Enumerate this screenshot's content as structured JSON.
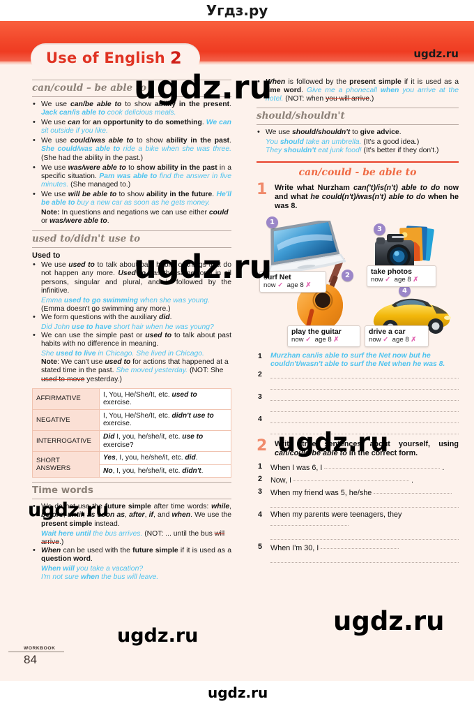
{
  "site": {
    "brand_top": "Угдз.ру",
    "brand_bottom": "ugdz.ru",
    "watermarks": [
      "ugdz.ru",
      "ugdz.ru",
      "ugdz.ru",
      "ugdz.ru",
      "ugdz.ru",
      "ugdz.ru",
      "ugdz.ru"
    ]
  },
  "header": {
    "title": "Use of English",
    "number": "2",
    "corner_brand": "ugdz.ru"
  },
  "footer": {
    "label": "WORKBOOK",
    "page": "84"
  },
  "left": {
    "s1": {
      "heading": "can/could – be able to",
      "bullets": [
        {
          "parts": [
            {
              "t": "We use ",
              "s": "n"
            },
            {
              "t": "can/be able to",
              "s": "bi"
            },
            {
              "t": " to show ",
              "s": "n"
            },
            {
              "t": "ability in the present",
              "s": "b"
            },
            {
              "t": ". ",
              "s": "n"
            },
            {
              "t": "Jack can/is able to",
              "s": "exb"
            },
            {
              "t": " cook delicious meals.",
              "s": "ex"
            }
          ]
        },
        {
          "parts": [
            {
              "t": "We use ",
              "s": "n"
            },
            {
              "t": "can",
              "s": "bi"
            },
            {
              "t": " for ",
              "s": "n"
            },
            {
              "t": "an opportunity to do something",
              "s": "b"
            },
            {
              "t": ". ",
              "s": "n"
            },
            {
              "t": "We can",
              "s": "exb"
            },
            {
              "t": " sit outside if you like.",
              "s": "ex"
            }
          ]
        },
        {
          "parts": [
            {
              "t": "We use ",
              "s": "n"
            },
            {
              "t": "could/was able to",
              "s": "bi"
            },
            {
              "t": " to show ",
              "s": "n"
            },
            {
              "t": "ability in the past",
              "s": "b"
            },
            {
              "t": ". ",
              "s": "n"
            },
            {
              "t": "She could/was able to",
              "s": "exb"
            },
            {
              "t": " ride a bike when she was three.",
              "s": "ex"
            },
            {
              "t": " (She had the ability in the past.)",
              "s": "n"
            }
          ]
        },
        {
          "parts": [
            {
              "t": "We use ",
              "s": "n"
            },
            {
              "t": "was/were able to",
              "s": "bi"
            },
            {
              "t": " to ",
              "s": "n"
            },
            {
              "t": "show ability in the past",
              "s": "b"
            },
            {
              "t": " in a specific situation. ",
              "s": "n"
            },
            {
              "t": "Pam was able to",
              "s": "exb"
            },
            {
              "t": " find the answer in five minutes.",
              "s": "ex"
            },
            {
              "t": " (She managed to.)",
              "s": "n"
            }
          ]
        },
        {
          "parts": [
            {
              "t": "We use ",
              "s": "n"
            },
            {
              "t": "will be able to",
              "s": "bi"
            },
            {
              "t": " to show ",
              "s": "n"
            },
            {
              "t": "ability in the future",
              "s": "b"
            },
            {
              "t": ". ",
              "s": "n"
            },
            {
              "t": "He'll be able to",
              "s": "exb"
            },
            {
              "t": " buy a new car as soon as he gets money.",
              "s": "ex"
            }
          ]
        }
      ],
      "note": {
        "parts": [
          {
            "t": "Note:",
            "s": "b"
          },
          {
            "t": " In questions and negations we can use either ",
            "s": "n"
          },
          {
            "t": "could",
            "s": "bi"
          },
          {
            "t": " or ",
            "s": "n"
          },
          {
            "t": "was/were able to",
            "s": "bi"
          },
          {
            "t": ".",
            "s": "n"
          }
        ]
      }
    },
    "s2": {
      "heading": "used to/didn't use to",
      "subhead": "Used to",
      "bullets": [
        {
          "parts": [
            {
              "t": "We use ",
              "s": "n"
            },
            {
              "t": "used to",
              "s": "bi"
            },
            {
              "t": " to talk about past habits or things that do not happen any more. ",
              "s": "n"
            },
            {
              "t": "Used to",
              "s": "bi"
            },
            {
              "t": " has the same form in all persons, singular and plural, and is followed by the infinitive.",
              "s": "n"
            }
          ]
        },
        {
          "parts": [
            {
              "t": "We form questions with the auxiliary ",
              "s": "n"
            },
            {
              "t": "did",
              "s": "bi"
            },
            {
              "t": ".",
              "s": "n"
            }
          ]
        },
        {
          "parts": [
            {
              "t": "We can use the simple past or ",
              "s": "n"
            },
            {
              "t": "used to",
              "s": "bi"
            },
            {
              "t": " to talk about past habits with no difference in meaning.",
              "s": "n"
            }
          ]
        }
      ],
      "ex1a": "Emma used to go swimming when she was young.",
      "ex1a_bold": "used to go swimming",
      "ex1b": "(Emma doesn't go swimming any more.)",
      "ex2a": "Did John use to have short hair when he was young?",
      "ex3a": "She used to live in Chicago. She lived in Chicago.",
      "note": {
        "parts": [
          {
            "t": "Note",
            "s": "b"
          },
          {
            "t": ": We can't use ",
            "s": "n"
          },
          {
            "t": "used to",
            "s": "bi"
          },
          {
            "t": " for actions that happened at a stated time in the past. ",
            "s": "n"
          },
          {
            "t": "She moved yesterday.",
            "s": "ex"
          },
          {
            "t": " (NOT: She ",
            "s": "n"
          },
          {
            "t": "used to move",
            "s": "strike"
          },
          {
            "t": " yesterday.)",
            "s": "n"
          }
        ]
      },
      "table": {
        "rows": [
          {
            "label": "AFFIRMATIVE",
            "cells": [
              [
                {
                  "t": "I, You, He/She/It, etc. ",
                  "s": "n"
                },
                {
                  "t": "used to",
                  "s": "bi"
                },
                {
                  "t": " exercise.",
                  "s": "n"
                }
              ]
            ]
          },
          {
            "label": "NEGATIVE",
            "cells": [
              [
                {
                  "t": "I, You, He/She/It, etc. ",
                  "s": "n"
                },
                {
                  "t": "didn't use to",
                  "s": "bi"
                },
                {
                  "t": " exercise.",
                  "s": "n"
                }
              ]
            ]
          },
          {
            "label": "INTERROGATIVE",
            "cells": [
              [
                {
                  "t": "Did",
                  "s": "bi"
                },
                {
                  "t": " I, you, he/she/it, etc. ",
                  "s": "n"
                },
                {
                  "t": "use to",
                  "s": "bi"
                },
                {
                  "t": " exercise?",
                  "s": "n"
                }
              ]
            ]
          },
          {
            "label": "SHORT ANSWERS",
            "cells": [
              [
                {
                  "t": "Yes",
                  "s": "bi"
                },
                {
                  "t": ", I, you, he/she/it, etc. ",
                  "s": "n"
                },
                {
                  "t": "did",
                  "s": "bi"
                },
                {
                  "t": ".",
                  "s": "n"
                }
              ],
              [
                {
                  "t": "No",
                  "s": "bi"
                },
                {
                  "t": ", I, you, he/she/it, etc. ",
                  "s": "n"
                },
                {
                  "t": "didn't",
                  "s": "bi"
                },
                {
                  "t": ".",
                  "s": "n"
                }
              ]
            ]
          }
        ]
      }
    },
    "s3": {
      "heading": "Time words",
      "bullets": [
        {
          "parts": [
            {
              "t": "We do not use the ",
              "s": "n"
            },
            {
              "t": "future simple",
              "s": "b"
            },
            {
              "t": " after time words: ",
              "s": "n"
            },
            {
              "t": "while",
              "s": "bi"
            },
            {
              "t": ", ",
              "s": "n"
            },
            {
              "t": "before",
              "s": "bi"
            },
            {
              "t": ", ",
              "s": "n"
            },
            {
              "t": "until",
              "s": "bi"
            },
            {
              "t": ", ",
              "s": "n"
            },
            {
              "t": "as soon as",
              "s": "bi"
            },
            {
              "t": ", ",
              "s": "n"
            },
            {
              "t": "after",
              "s": "bi"
            },
            {
              "t": ", ",
              "s": "n"
            },
            {
              "t": "if",
              "s": "bi"
            },
            {
              "t": ", and ",
              "s": "n"
            },
            {
              "t": "when",
              "s": "bi"
            },
            {
              "t": ". We use the ",
              "s": "n"
            },
            {
              "t": "present simple",
              "s": "b"
            },
            {
              "t": " instead.",
              "s": "n"
            }
          ]
        },
        {
          "parts": [
            {
              "t": "When",
              "s": "bi"
            },
            {
              "t": " can be used with the ",
              "s": "n"
            },
            {
              "t": "future simple",
              "s": "b"
            },
            {
              "t": " if it is used as a ",
              "s": "n"
            },
            {
              "t": "question word",
              "s": "b"
            },
            {
              "t": ".",
              "s": "n"
            }
          ]
        }
      ],
      "ex1_blue_bold": "Wait here until",
      "ex1_blue": " the bus arrives.",
      "ex1_tail_a": " (NOT: ... until the bus ",
      "ex1_strike": "will arrive",
      "ex1_tail_b": ".)",
      "ex2_bold": "When will",
      "ex2_rest": " you take a vacation?",
      "ex3_a": "I'm not sure ",
      "ex3_bold": "when",
      "ex3_b": " the bus will leave."
    }
  },
  "right": {
    "s1": {
      "bullets": [
        {
          "parts": [
            {
              "t": "When",
              "s": "bi"
            },
            {
              "t": " is followed by the ",
              "s": "n"
            },
            {
              "t": "present simple",
              "s": "b"
            },
            {
              "t": " if it is used as a ",
              "s": "n"
            },
            {
              "t": "time word",
              "s": "b"
            },
            {
              "t": ". ",
              "s": "n"
            },
            {
              "t": "Give me a phonecall ",
              "s": "ex"
            },
            {
              "t": "when",
              "s": "exb"
            },
            {
              "t": " you arrive at the hotel.",
              "s": "ex"
            },
            {
              "t": " (NOT: when ",
              "s": "n"
            },
            {
              "t": "you will arrive",
              "s": "strike"
            },
            {
              "t": ".)",
              "s": "n"
            }
          ]
        }
      ]
    },
    "s2": {
      "heading": "should/shouldn't",
      "bullets": [
        {
          "parts": [
            {
              "t": "We use ",
              "s": "n"
            },
            {
              "t": "should/shouldn't",
              "s": "bi"
            },
            {
              "t": " to ",
              "s": "n"
            },
            {
              "t": "give advice",
              "s": "b"
            },
            {
              "t": ".",
              "s": "n"
            }
          ]
        }
      ],
      "ex1_a": "You ",
      "ex1_bold": "should",
      "ex1_b": " take an umbrella.",
      "ex1_tail": " (It's a good idea.)",
      "ex2_a": "They ",
      "ex2_bold": "shouldn't",
      "ex2_b": " eat junk food!",
      "ex2_tail": " (It's better if they don't.)"
    },
    "exercise_title": "can/could - be able to",
    "task1": {
      "number": "1",
      "instruction_parts": [
        {
          "t": "Write what Nurzham ",
          "s": "b"
        },
        {
          "t": "can('t)/is(n't) able to do",
          "s": "bi"
        },
        {
          "t": " now and what ",
          "s": "b"
        },
        {
          "t": "he could(n't)/was(n't) able to do",
          "s": "bi"
        },
        {
          "t": " when he was 8.",
          "s": "b"
        }
      ],
      "items": [
        {
          "badge": "1",
          "label": "surf Net",
          "now": "now",
          "now_mark": "✓",
          "age": "age 8",
          "age_mark": "✗",
          "icon": "laptop-icon"
        },
        {
          "badge": "2",
          "label": "play the guitar",
          "now": "now",
          "now_mark": "✓",
          "age": "age 8",
          "age_mark": "✗",
          "icon": "guitar-icon"
        },
        {
          "badge": "3",
          "label": "take photos",
          "now": "now",
          "now_mark": "✓",
          "age": "age 8",
          "age_mark": "✗",
          "icon": "camera-icon"
        },
        {
          "badge": "4",
          "label": "drive a car",
          "now": "now",
          "now_mark": "✓",
          "age": "age 8",
          "age_mark": "✗",
          "icon": "car-icon"
        }
      ],
      "answers": [
        {
          "n": "1",
          "text": "Murzhan can/is able to surf the Net now but he couldn't/wasn't able to surf the Net when he was 8.",
          "filled": true
        },
        {
          "n": "2",
          "text": "",
          "filled": false
        },
        {
          "n": "3",
          "text": "",
          "filled": false
        },
        {
          "n": "4",
          "text": "",
          "filled": false
        }
      ]
    },
    "task2": {
      "number": "2",
      "instruction_parts": [
        {
          "t": "Write true sentences about yourself, using ",
          "s": "b"
        },
        {
          "t": "can/could/be able to",
          "s": "bi"
        },
        {
          "t": " in the correct form.",
          "s": "b"
        }
      ],
      "questions": [
        {
          "n": "1",
          "stem": "When I was 6, I",
          "lines": 1
        },
        {
          "n": "2",
          "stem": "Now, I",
          "lines": 1
        },
        {
          "n": "3",
          "stem": "When my friend was 5, he/she",
          "lines": 2
        },
        {
          "n": "4",
          "stem": "When my parents were teenagers, they",
          "lines": 2
        },
        {
          "n": "5",
          "stem": "When I'm 30, I",
          "lines": 2
        }
      ]
    }
  }
}
